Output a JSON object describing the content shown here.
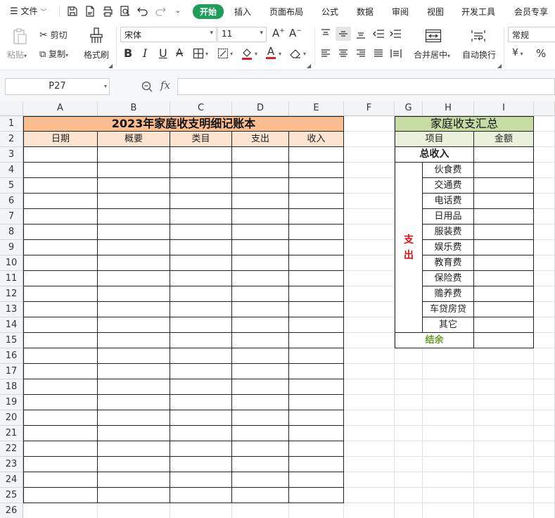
{
  "menubar": {
    "menu_label": "文件",
    "tabs": [
      "开始",
      "插入",
      "页面布局",
      "公式",
      "数据",
      "审阅",
      "视图",
      "开发工具",
      "会员专享"
    ],
    "active_tab": "开始"
  },
  "ribbon": {
    "paste": "粘贴",
    "cut": "剪切",
    "copy": "复制",
    "format_painter": "格式刷",
    "font_name": "宋体",
    "font_size": "11",
    "bold": "B",
    "italic": "I",
    "underline": "U",
    "merge_center": "合并居中",
    "wrap_text": "自动换行",
    "number_format": "常规",
    "currency": "¥",
    "percent": "%"
  },
  "formula_bar": {
    "cell_ref": "P27",
    "fx": "fx",
    "formula": ""
  },
  "sheet": {
    "columns": [
      "A",
      "B",
      "C",
      "D",
      "E",
      "F",
      "G",
      "H",
      "I"
    ],
    "rows": [
      "1",
      "2",
      "3",
      "4",
      "5",
      "6",
      "7",
      "8",
      "9",
      "10",
      "11",
      "12",
      "13",
      "14",
      "15",
      "16",
      "17",
      "18",
      "19",
      "20",
      "21",
      "22",
      "23",
      "24",
      "25",
      "26"
    ],
    "ledger": {
      "title": "2023年家庭收支明细记账本",
      "headers": [
        "日期",
        "概要",
        "类目",
        "支出",
        "收入"
      ]
    },
    "summary": {
      "title": "家庭收支汇总",
      "header_item": "项目",
      "header_amount": "金额",
      "total_income": "总收入",
      "expense_label": "支\n出",
      "expense_items": [
        "伙食费",
        "交通费",
        "电话费",
        "日用品",
        "服装费",
        "娱乐费",
        "教育费",
        "保险费",
        "赡养费",
        "车贷房贷",
        "其它"
      ],
      "balance": "结余"
    },
    "colors": {
      "ledger_title_bg": "#f9bd8f",
      "ledger_header_bg": "#fde4d0",
      "summary_title_bg": "#c6dca4",
      "summary_header_bg": "#e8f1dc",
      "expense_text": "#e01010",
      "balance_text": "#6a9a2a"
    }
  }
}
